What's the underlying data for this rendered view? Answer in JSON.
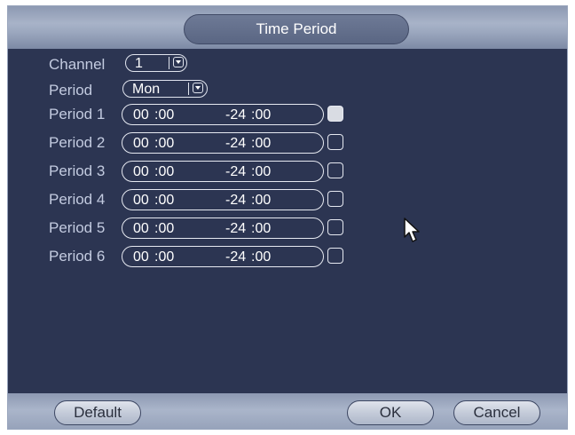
{
  "dialog": {
    "title": "Time Period"
  },
  "channel": {
    "label": "Channel",
    "value": "1"
  },
  "period": {
    "label": "Period",
    "value": "Mon"
  },
  "periods": [
    {
      "label": "Period 1",
      "start_h": "00",
      "start_m": ":00",
      "end_h": "-24",
      "end_m": ":00",
      "checked": true
    },
    {
      "label": "Period 2",
      "start_h": "00",
      "start_m": ":00",
      "end_h": "-24",
      "end_m": ":00",
      "checked": false
    },
    {
      "label": "Period 3",
      "start_h": "00",
      "start_m": ":00",
      "end_h": "-24",
      "end_m": ":00",
      "checked": false
    },
    {
      "label": "Period 4",
      "start_h": "00",
      "start_m": ":00",
      "end_h": "-24",
      "end_m": ":00",
      "checked": false
    },
    {
      "label": "Period 5",
      "start_h": "00",
      "start_m": ":00",
      "end_h": "-24",
      "end_m": ":00",
      "checked": false
    },
    {
      "label": "Period 6",
      "start_h": "00",
      "start_m": ":00",
      "end_h": "-24",
      "end_m": ":00",
      "checked": false
    }
  ],
  "buttons": {
    "default": "Default",
    "ok": "OK",
    "cancel": "Cancel"
  },
  "colors": {
    "panel": "#2c3552",
    "label": "#c3cbe0",
    "titlebar": "#9ca8bf"
  },
  "icons": {
    "cursor": "mouse-pointer-icon",
    "dropdown": "chevron-down-icon"
  }
}
